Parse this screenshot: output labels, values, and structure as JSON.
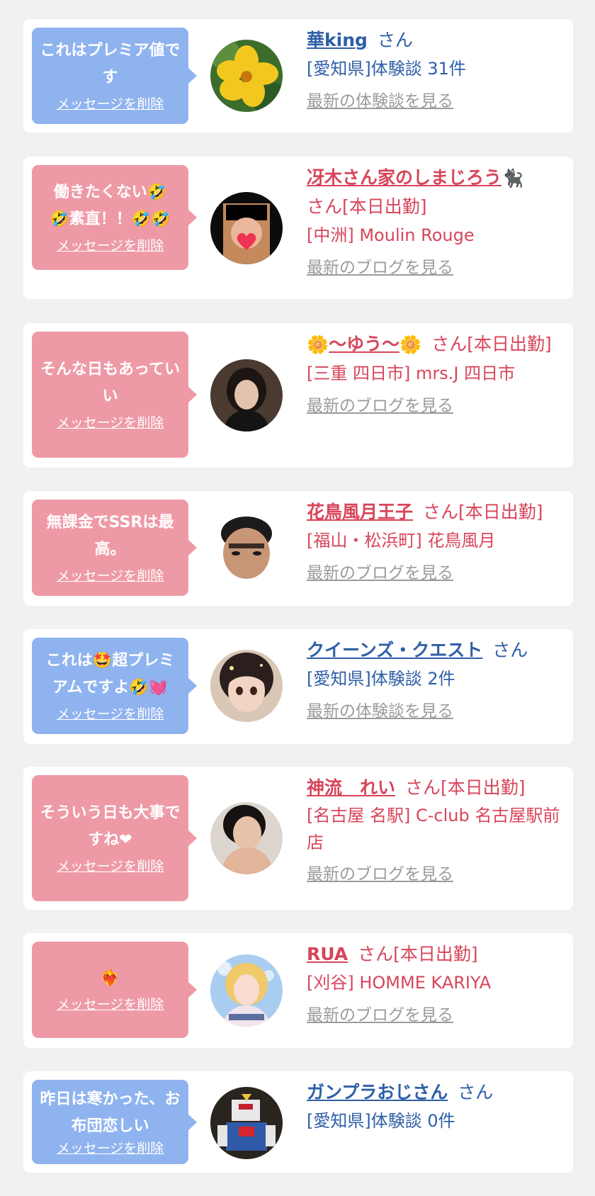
{
  "delete_label": "メッセージを削除",
  "items": [
    {
      "bubble_text": "これはプレミア値です",
      "name": "華king",
      "suffix": "さん",
      "meta": "[愛知県]体験談 31件",
      "link": "最新の体験談を見る"
    },
    {
      "bubble_text": "働きたくない🤣🤣素直！！🤣🤣",
      "name": "冴木さん家のしまじろう",
      "suffix": "さん[本日出勤]",
      "meta": "[中洲] Moulin Rouge",
      "link": "最新のブログを見る"
    },
    {
      "bubble_text": "そんな日もあっていい",
      "name": "〜ゆう〜",
      "suffix": "さん[本日出勤]",
      "meta": "[三重 四日市] mrs.J 四日市",
      "link": "最新のブログを見る"
    },
    {
      "bubble_text": "無課金でSSRは最高。",
      "name": "花鳥風月王子",
      "suffix": "さん[本日出勤]",
      "meta": "[福山・松浜町] 花鳥風月",
      "link": "最新のブログを見る"
    },
    {
      "bubble_text": "これは🤩超プレミアムですよ🤣💓",
      "name": "クイーンズ・クエスト",
      "suffix": "さん",
      "meta": "[愛知県]体験談 2件",
      "link": "最新の体験談を見る"
    },
    {
      "bubble_text": "そういう日も大事ですね❤",
      "name": "神流　れい",
      "suffix": "さん[本日出勤]",
      "meta": "[名古屋 名駅] C-club 名古屋駅前店",
      "link": "最新のブログを見る"
    },
    {
      "bubble_text": "❤‍🔥",
      "name": "RUA",
      "suffix": "さん[本日出勤]",
      "meta": "[刈谷] HOMME KARIYA",
      "link": "最新のブログを見る"
    },
    {
      "bubble_text": "昨日は寒かった、お布団恋しい",
      "name": "ガンプラおじさん",
      "suffix": "さん",
      "meta": "[愛知県]体験談 0件",
      "link": ""
    }
  ]
}
